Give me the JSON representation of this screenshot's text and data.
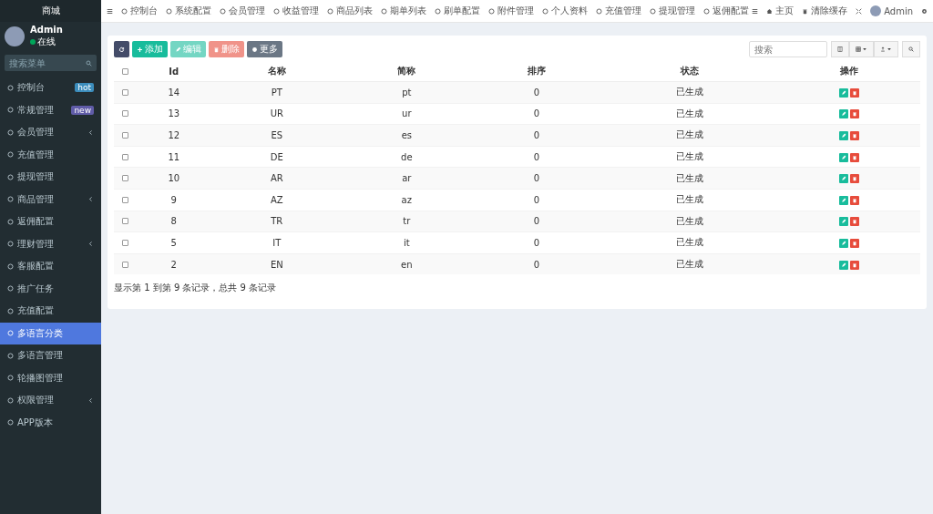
{
  "sidebar": {
    "logo": "商城",
    "user": {
      "name": "Admin",
      "status": "在线"
    },
    "search": {
      "placeholder": "搜索菜单"
    },
    "items": [
      {
        "label": "控制台",
        "badge": "hot",
        "color": "#3c8dbc",
        "has_children": false,
        "selected": false
      },
      {
        "label": "常规管理",
        "badge": "new",
        "color": "#605ca8",
        "has_children": false,
        "selected": false
      },
      {
        "label": "会员管理",
        "has_children": true,
        "selected": false
      },
      {
        "label": "充值管理",
        "has_children": false,
        "selected": false
      },
      {
        "label": "提现管理",
        "has_children": false,
        "selected": false
      },
      {
        "label": "商品管理",
        "has_children": true,
        "selected": false
      },
      {
        "label": "返佣配置",
        "has_children": false,
        "selected": false
      },
      {
        "label": "理财管理",
        "has_children": true,
        "selected": false
      },
      {
        "label": "客服配置",
        "has_children": false,
        "selected": false
      },
      {
        "label": "推广任务",
        "has_children": false,
        "selected": false
      },
      {
        "label": "充值配置",
        "has_children": false,
        "selected": false
      },
      {
        "label": "多语言分类",
        "has_children": false,
        "selected": true
      },
      {
        "label": "多语言管理",
        "has_children": false,
        "selected": false
      },
      {
        "label": "轮播图管理",
        "has_children": false,
        "selected": false
      },
      {
        "label": "权限管理",
        "has_children": true,
        "selected": false
      },
      {
        "label": "APP版本",
        "has_children": false,
        "selected": false
      }
    ]
  },
  "nav_tabs": [
    "控制台",
    "系统配置",
    "会员管理",
    "收益管理",
    "商品列表",
    "期单列表",
    "刷单配置",
    "附件管理",
    "个人资料",
    "充值管理",
    "提现管理",
    "返佣配置"
  ],
  "top_right": {
    "home": "主页",
    "clear_cache": "清除缓存",
    "user": "Admin"
  },
  "toolbar": {
    "buttons": [
      {
        "kind": "refresh",
        "disabled": false
      },
      {
        "label": "添加",
        "kind": "add",
        "disabled": false
      },
      {
        "label": "编辑",
        "kind": "edit",
        "disabled": true
      },
      {
        "label": "删除",
        "kind": "delete",
        "disabled": true
      },
      {
        "label": "更多",
        "kind": "more",
        "disabled": false
      }
    ],
    "search": {
      "placeholder": "搜索"
    }
  },
  "table": {
    "select_all_checked": false,
    "columns": [
      "Id",
      "名称",
      "简称",
      "排序",
      "状态",
      "操作"
    ],
    "rows": [
      {
        "id": "14",
        "name": "PT",
        "short": "pt",
        "sort": "0",
        "status": "已生成",
        "checked": false
      },
      {
        "id": "13",
        "name": "UR",
        "short": "ur",
        "sort": "0",
        "status": "已生成",
        "checked": false
      },
      {
        "id": "12",
        "name": "ES",
        "short": "es",
        "sort": "0",
        "status": "已生成",
        "checked": false
      },
      {
        "id": "11",
        "name": "DE",
        "short": "de",
        "sort": "0",
        "status": "已生成",
        "checked": false
      },
      {
        "id": "10",
        "name": "AR",
        "short": "ar",
        "sort": "0",
        "status": "已生成",
        "checked": false
      },
      {
        "id": "9",
        "name": "AZ",
        "short": "az",
        "sort": "0",
        "status": "已生成",
        "checked": false
      },
      {
        "id": "8",
        "name": "TR",
        "short": "tr",
        "sort": "0",
        "status": "已生成",
        "checked": false
      },
      {
        "id": "5",
        "name": "IT",
        "short": "it",
        "sort": "0",
        "status": "已生成",
        "checked": false
      },
      {
        "id": "2",
        "name": "EN",
        "short": "en",
        "sort": "0",
        "status": "已生成",
        "checked": false
      }
    ],
    "footer": "显示第 1 到第 9 条记录，总共 9 条记录"
  }
}
